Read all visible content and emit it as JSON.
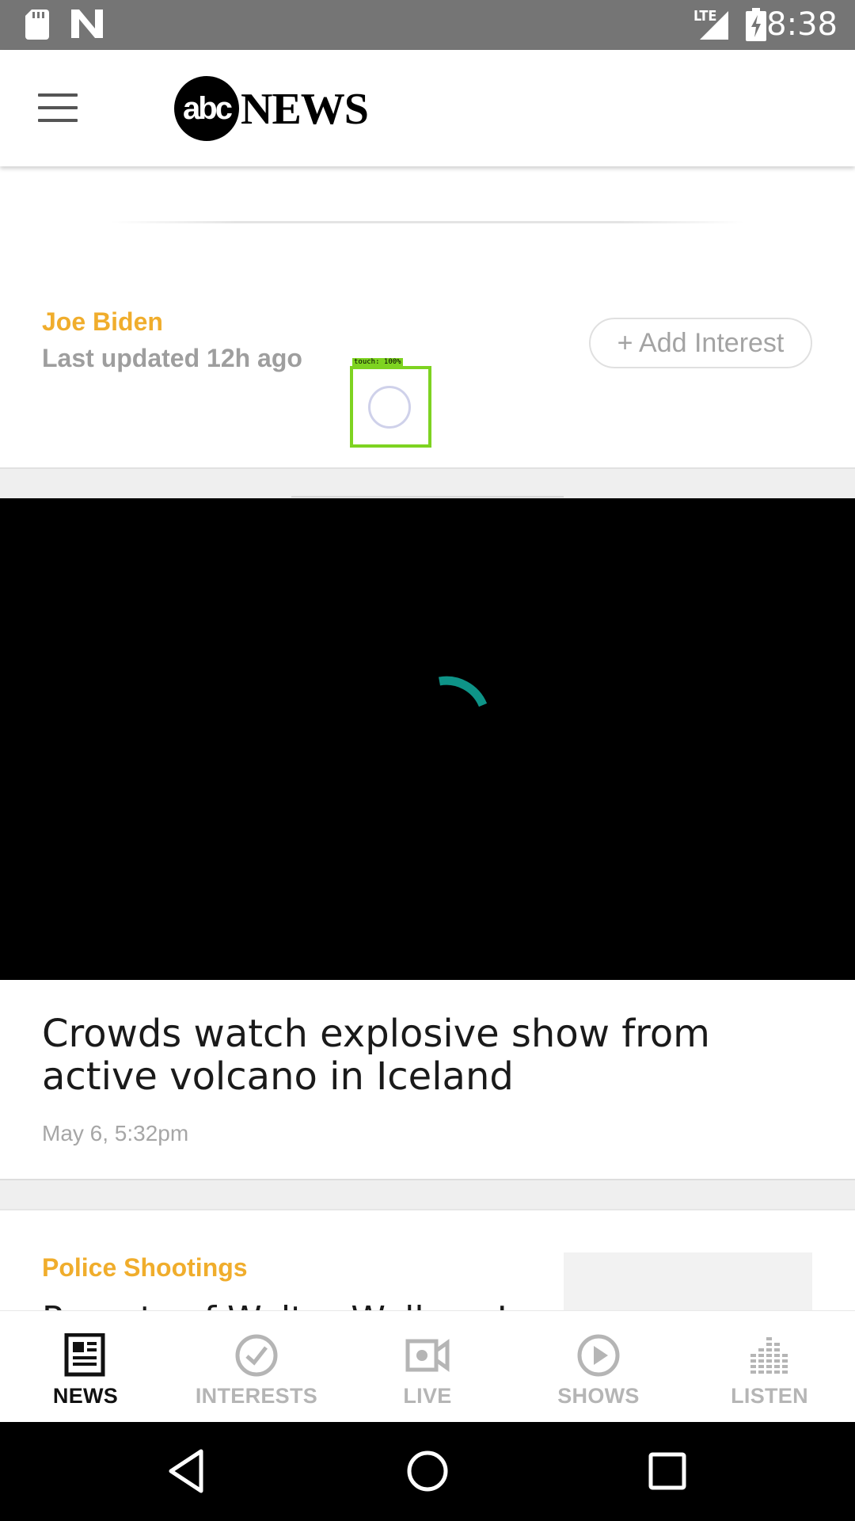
{
  "status_bar": {
    "time": "8:38",
    "network_label": "LTE",
    "icons": [
      "sd-card-icon",
      "n-notification-icon",
      "signal-icon",
      "battery-charging-icon"
    ]
  },
  "app_bar": {
    "logo_abc": "abc",
    "logo_news": "NEWS",
    "menu_icon": "hamburger-menu-icon"
  },
  "interest": {
    "title": "Joe Biden",
    "last_updated": "Last updated 12h ago",
    "add_button_label": "+ Add Interest"
  },
  "touch_overlay": {
    "label": "touch: 100%"
  },
  "video": {
    "state_icon": "loading-spinner-icon",
    "spinner_color": "#0e9488"
  },
  "article": {
    "headline": "Crowds watch explosive show from active volcano in Iceland",
    "date": "May 6, 5:32pm"
  },
  "next_card": {
    "topic": "Police Shootings",
    "headline_partial": "Parents of Walter Wallace J"
  },
  "bottom_nav": {
    "items": [
      {
        "label": "NEWS",
        "icon": "newspaper-icon",
        "active": true
      },
      {
        "label": "INTERESTS",
        "icon": "checkmark-circle-icon",
        "active": false
      },
      {
        "label": "LIVE",
        "icon": "video-camera-icon",
        "active": false
      },
      {
        "label": "SHOWS",
        "icon": "play-circle-icon",
        "active": false
      },
      {
        "label": "LISTEN",
        "icon": "equalizer-icon",
        "active": false
      }
    ]
  },
  "colors": {
    "accent": "#f0ad2c",
    "status_bar": "#757575",
    "active_nav": "#111111",
    "inactive_nav": "#b5b5b5"
  }
}
